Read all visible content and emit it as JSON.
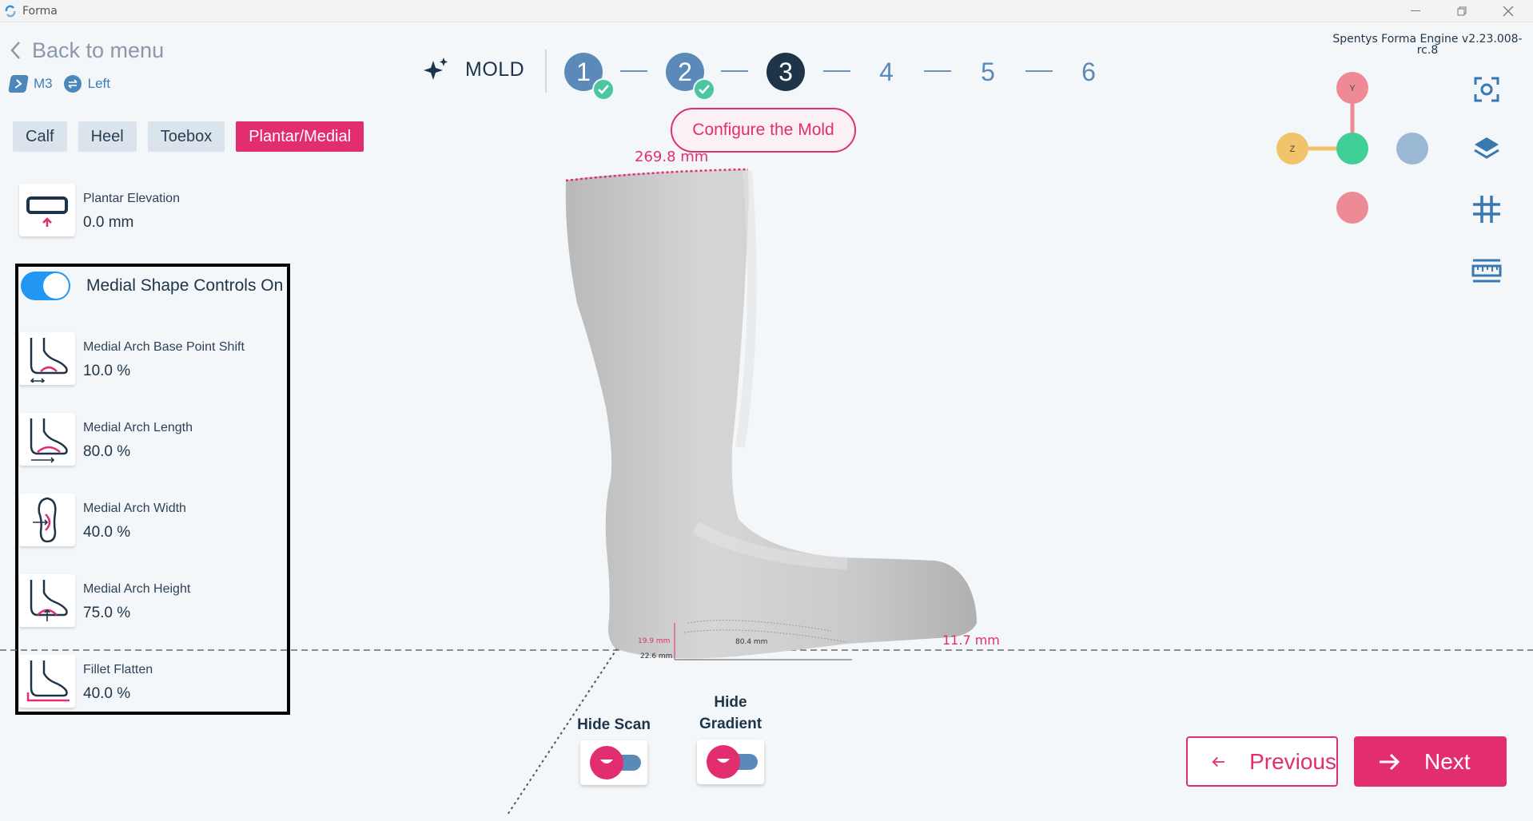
{
  "window": {
    "title": "Forma"
  },
  "header": {
    "back_label": "Back to menu",
    "tags": [
      {
        "label": "M3",
        "icon": "hexagon-icon"
      },
      {
        "label": "Left",
        "icon": "swap-icon"
      }
    ],
    "engine_version": "Spentys Forma Engine v2.23.008-rc.8"
  },
  "tabs": [
    {
      "label": "Calf",
      "active": false
    },
    {
      "label": "Heel",
      "active": false
    },
    {
      "label": "Toebox",
      "active": false
    },
    {
      "label": "Plantar/Medial",
      "active": true
    }
  ],
  "stepper": {
    "section_label": "MOLD",
    "steps": [
      {
        "label": "1",
        "state": "done"
      },
      {
        "label": "2",
        "state": "done"
      },
      {
        "label": "3",
        "state": "current"
      },
      {
        "label": "4",
        "state": "future"
      },
      {
        "label": "5",
        "state": "future"
      },
      {
        "label": "6",
        "state": "future"
      }
    ],
    "current_hint": "Configure the Mold"
  },
  "params": {
    "plantar_elevation": {
      "label": "Plantar Elevation",
      "value": "0.0 mm"
    },
    "medial_toggle_label": "Medial Shape Controls On",
    "medial_toggle_on": true,
    "items": [
      {
        "label": "Medial Arch Base Point Shift",
        "value": "10.0 %"
      },
      {
        "label": "Medial Arch Length",
        "value": "80.0 %"
      },
      {
        "label": "Medial Arch Width",
        "value": "40.0 %"
      },
      {
        "label": "Medial Arch Height",
        "value": "75.0 %"
      },
      {
        "label": "Fillet Flatten",
        "value": "40.0 %"
      }
    ]
  },
  "viewport": {
    "top_width": "269.8 mm",
    "toe_height": "11.7 mm",
    "small_dim_1": "19.9 mm",
    "small_dim_2": "22.6 mm",
    "small_dim_3": "80.4 mm"
  },
  "axes": {
    "y_label": "Y",
    "z_label": "Z"
  },
  "bottom": {
    "hide_scan_label": "Hide Scan",
    "hide_gradient_line1": "Hide",
    "hide_gradient_line2": "Gradient",
    "previous_label": "Previous",
    "next_label": "Next"
  },
  "colors": {
    "accent": "#e32d71",
    "primary": "#1e3448",
    "step": "#5b8ab8",
    "check": "#4cc6a0",
    "toggle": "#2196f3"
  }
}
